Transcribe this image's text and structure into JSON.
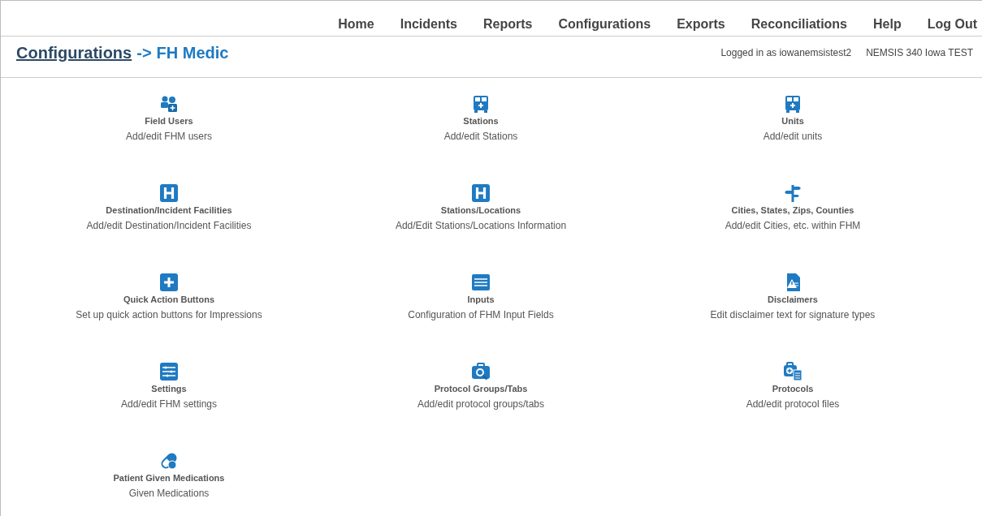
{
  "nav": [
    {
      "label": "Home"
    },
    {
      "label": "Incidents"
    },
    {
      "label": "Reports"
    },
    {
      "label": "Configurations"
    },
    {
      "label": "Exports"
    },
    {
      "label": "Reconciliations"
    },
    {
      "label": "Help"
    },
    {
      "label": "Log Out"
    }
  ],
  "breadcrumb": {
    "link": "Configurations",
    "separator": "->",
    "current": "FH Medic"
  },
  "user_info": [
    "Logged in as iowanemsistest2",
    "NEMSIS 340 Iowa TEST"
  ],
  "tiles": [
    {
      "title": "Field Users",
      "description": "Add/edit FHM users"
    },
    {
      "title": "Stations",
      "description": "Add/edit Stations"
    },
    {
      "title": "Units",
      "description": "Add/edit units"
    },
    {
      "title": "Destination/Incident Facilities",
      "description": "Add/edit Destination/Incident Facilities"
    },
    {
      "title": "Stations/Locations",
      "description": "Add/Edit Stations/Locations Information"
    },
    {
      "title": "Cities, States, Zips, Counties",
      "description": "Add/edit Cities, etc. within FHM"
    },
    {
      "title": "Quick Action Buttons",
      "description": "Set up quick action buttons for Impressions"
    },
    {
      "title": "Inputs",
      "description": "Configuration of FHM Input Fields"
    },
    {
      "title": "Disclaimers",
      "description": "Edit disclaimer text for signature types"
    },
    {
      "title": "Settings",
      "description": "Add/edit FHM settings"
    },
    {
      "title": "Protocol Groups/Tabs",
      "description": "Add/edit protocol groups/tabs"
    },
    {
      "title": "Protocols",
      "description": "Add/edit protocol files"
    },
    {
      "title": "Patient Given Medications",
      "description": "Given Medications"
    }
  ]
}
